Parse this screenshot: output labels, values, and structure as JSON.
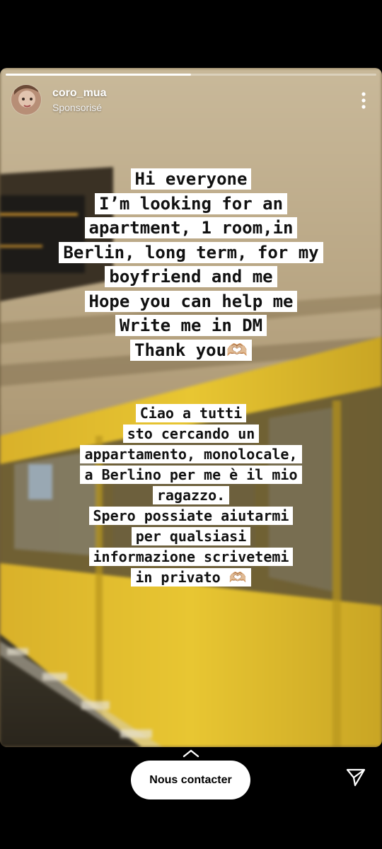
{
  "story": {
    "username": "coro_mua",
    "sponsored_label": "Sponsorisé",
    "progress": 0.5
  },
  "english_text": {
    "lines": [
      "Hi everyone",
      "I’m looking for an",
      "apartment, 1 room,in",
      "Berlin, long term, for my",
      "boyfriend and me",
      "Hope you can help me",
      "Write me in DM",
      "Thank you🫶🏼"
    ]
  },
  "italian_text": {
    "lines": [
      "Ciao a tutti",
      "sto cercando un",
      "appartamento, monolocale,",
      "a Berlino per me è il mio",
      "ragazzo.",
      "Spero possiate aiutarmi",
      "per qualsiasi",
      "informazione scrivetemi",
      "in privato 🫶🏼"
    ]
  },
  "footer": {
    "cta_label": "Nous contacter",
    "swipe_up_icon": "chevron-up-icon",
    "send_icon": "paper-plane-icon"
  },
  "colors": {
    "train_yellow": "#e8c632",
    "text_highlight": "#ffffff"
  }
}
